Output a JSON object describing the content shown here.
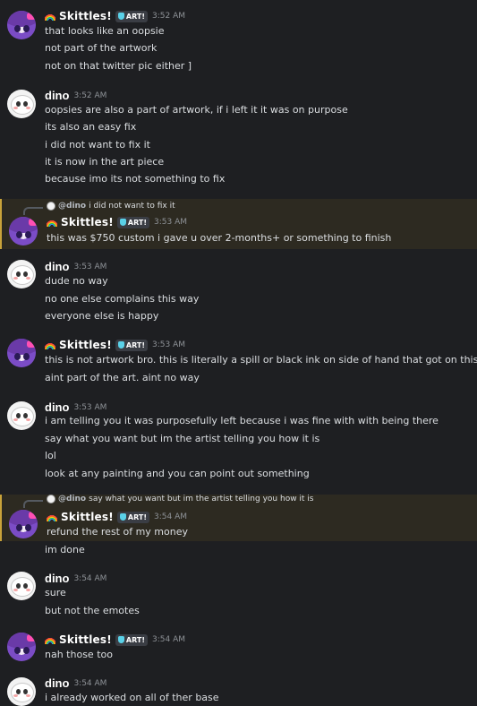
{
  "users": {
    "skittles": {
      "name": "Skittles!",
      "badge": "ART!"
    },
    "dino": {
      "name": "dino"
    }
  },
  "messages": [
    {
      "author": "skittles",
      "time": "3:52 AM",
      "lines": [
        "that looks like an oopsie",
        "not part of the artwork",
        "not on that twitter pic either ]"
      ]
    },
    {
      "author": "dino",
      "time": "3:52 AM",
      "lines": [
        "oopsies are also a part of artwork, if i left it it was on purpose",
        "its also an easy fix",
        "i did not want to fix it",
        "it is now in the art piece",
        "because imo its not something to fix"
      ]
    },
    {
      "author": "skittles",
      "time": "3:53 AM",
      "reply": {
        "name": "@dino",
        "text": "i did not want to fix it"
      },
      "lines": [
        "this was $750 custom i gave u over 2-months+ or something to finish"
      ]
    },
    {
      "author": "dino",
      "time": "3:53 AM",
      "lines": [
        "dude no way",
        "no one else complains this way",
        "everyone else is happy"
      ]
    },
    {
      "author": "skittles",
      "time": "3:53 AM",
      "lines": [
        "this is not artwork bro. this is literally a spill or black ink on side of hand that got on this",
        "aint part of the art. aint no way"
      ]
    },
    {
      "author": "dino",
      "time": "3:53 AM",
      "lines": [
        "i am telling you it was purposefully left because i was fine with with being there",
        "say what you want but im the artist telling you how it is",
        "lol",
        "look at any painting and you can point out something"
      ]
    },
    {
      "author": "skittles",
      "time": "3:54 AM",
      "reply": {
        "name": "@dino",
        "text": "say what you want but im the artist telling you how it is"
      },
      "lines": [
        "refund the rest of my money",
        "im done"
      ]
    },
    {
      "author": "dino",
      "time": "3:54 AM",
      "lines": [
        "sure",
        "but not the emotes"
      ]
    },
    {
      "author": "skittles",
      "time": "3:54 AM",
      "lines": [
        "nah those too"
      ]
    },
    {
      "author": "dino",
      "time": "3:54 AM",
      "lines": [
        "i already worked on all of ther base"
      ]
    }
  ],
  "colors": {
    "background": "#1e1f22",
    "highlight": "#2d2a21",
    "text": "#dbdee1",
    "timestamp": "#8e9297",
    "badge_icon": "#5ad1e8"
  }
}
